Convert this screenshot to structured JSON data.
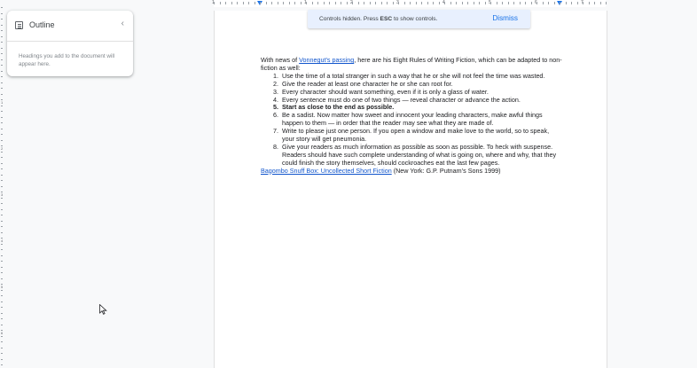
{
  "outline": {
    "title": "Outline",
    "collapse_icon": "chevron-left-icon",
    "collapse_glyph": "‹",
    "empty_text": "Headings you add to the document will appear here."
  },
  "toast": {
    "message_pre": "Controls hidden. Press ",
    "message_key": "ESC",
    "message_post": " to show controls.",
    "dismiss_label": "Dismiss"
  },
  "ruler": {
    "numbers": [
      "1",
      "1",
      "2",
      "3",
      "4",
      "5",
      "6",
      "7"
    ],
    "left_numbers": [
      "1",
      "2",
      "3",
      "4",
      "5",
      "6"
    ]
  },
  "document": {
    "intro_pre": "With news of ",
    "intro_link": "Vonnegut's passing",
    "intro_post": ", here are his Eight Rules of Writing Fiction, which can be adapted to non-fiction as well:",
    "rules": [
      "Use the time of a total stranger in such a way that he or she will not feel the time was wasted.",
      "Give the reader at least one character he or she can root for.",
      "Every character should want something, even if it is only a glass of water.",
      "Every sentence must do one of two things — reveal character or advance the action.",
      "Start as close to the end as possible.",
      "Be a sadist. Now matter how sweet and innocent your leading characters, make awful things happen to them — in order that the reader may see what they are made of.",
      "Write to please just one person. If you open a window and make love to the world, so to speak, your story will get pneumonia.",
      "Give your readers as much information as possible as soon as possible. To heck with suspense. Readers should have such complete understanding of what is going on, where and why, that they could finish the story themselves, should cockroaches eat the last few pages."
    ],
    "citation_link": "Bagombo Snuff Box: Uncollected Short Fiction",
    "citation_rest": " (New York: G.P. Putnam’s Sons 1999)"
  },
  "colors": {
    "accent": "#1a73e8",
    "link": "#1155cc",
    "toast_bg": "#e8f0fe"
  }
}
